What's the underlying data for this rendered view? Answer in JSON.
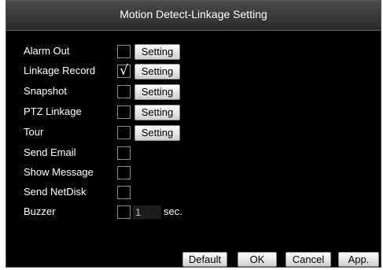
{
  "window": {
    "title": "Motion Detect-Linkage Setting"
  },
  "rows": [
    {
      "label": "Alarm Out",
      "checked": false,
      "button": "Setting"
    },
    {
      "label": "Linkage Record",
      "checked": true,
      "button": "Setting",
      "check_glyph": "√"
    },
    {
      "label": "Snapshot",
      "checked": false,
      "button": "Setting"
    },
    {
      "label": "PTZ Linkage",
      "checked": false,
      "button": "Setting"
    },
    {
      "label": "Tour",
      "checked": false,
      "button": "Setting"
    },
    {
      "label": "Send Email",
      "checked": false
    },
    {
      "label": "Show Message",
      "checked": false
    },
    {
      "label": "Send NetDisk",
      "checked": false
    },
    {
      "label": "Buzzer",
      "checked": false,
      "value": "1",
      "unit": "sec."
    }
  ],
  "footer": {
    "default_label": "Default",
    "ok_label": "OK",
    "cancel_label": "Cancel",
    "apply_label": "App."
  }
}
